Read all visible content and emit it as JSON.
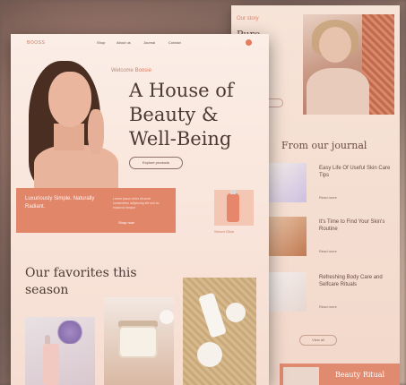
{
  "back_page": {
    "tag": "Our story",
    "heading": "Pure",
    "journal_title": "From our journal",
    "journal_items": [
      {
        "title": "Easy Life Of Useful Skin Care Tips",
        "link": "Read more"
      },
      {
        "title": "It's Time to Find Your Skin's Routine",
        "link": "Read more"
      },
      {
        "title": "Refreshing Body Care and Selfcare Rituals",
        "link": "Read more"
      }
    ],
    "view_all": "View all",
    "banner_text": "Beauty Ritual"
  },
  "main_page": {
    "logo": "BOOSS",
    "nav": [
      "Shop",
      "About us",
      "Journal",
      "Contact"
    ],
    "welcome_prefix": "Welcome",
    "welcome_brand": "Boosie",
    "hero_title": "A House of Beauty & Well-Being",
    "hero_button": "Explore products",
    "promo_text": "Luxuriously Simple. Naturally Radiant.",
    "promo_desc": "Lorem ipsum dolor sit amet consectetur adipiscing elit sed do eiusmod tempor",
    "promo_link": "Shop now",
    "bottle_label": "Serum Glow",
    "favorites_title": "Our favorites this season"
  }
}
